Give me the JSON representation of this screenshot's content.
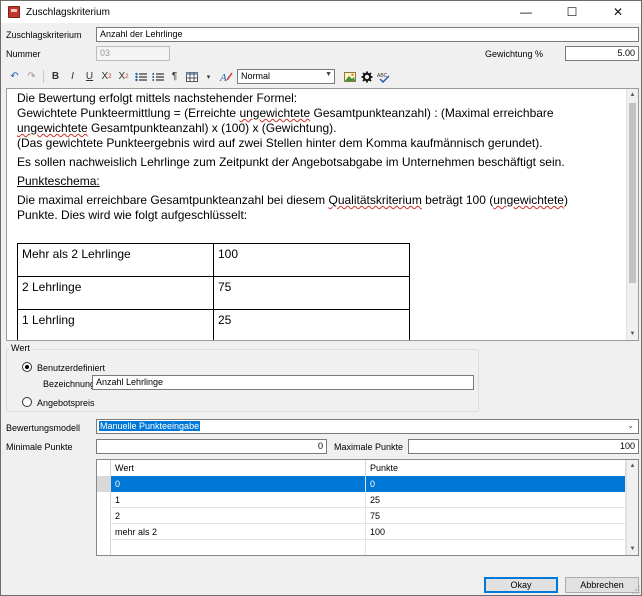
{
  "window": {
    "title": "Zuschlagskriterium",
    "minimize": "—",
    "maximize": "☐",
    "close": "✕"
  },
  "form": {
    "kriterium_label": "Zuschlagskriterium",
    "kriterium_value": "Anzahl der Lehrlinge",
    "nummer_label": "Nummer",
    "nummer_value": "03",
    "gewichtung_label": "Gewichtung %",
    "gewichtung_value": "5.00"
  },
  "toolbar": {
    "bold": "B",
    "italic": "I",
    "underline": "U",
    "superscript": "X",
    "subscript": "X",
    "superscript_mark": "2",
    "subscript_mark": "2",
    "paragraph": "¶",
    "style_value": "Normal"
  },
  "editor": {
    "line1": " Die Bewertung erfolgt mittels nachstehender Formel:",
    "formula_a": "Gewichtete Punkteermittlung = (Erreichte ",
    "formula_b": "ungewichtete",
    "formula_c": " Gesamtpunkteanzahl) : (Maximal erreichbare ",
    "formula_d": "ungewichtete",
    "formula_e": " Gesamtpunkteanzahl) x (100) x (Gewichtung).",
    "rounding": "(Das gewichtete Punkteergebnis wird auf zwei Stellen hinter dem Komma kaufmännisch gerundet).",
    "requirement": "Es sollen nachweislich Lehrlinge zum Zeitpunkt der Angebotsabgabe im Unternehmen beschäftigt sein.",
    "schema_heading": "Punkteschema:",
    "max_a": "Die maximal erreichbare Gesamtpunkteanzahl bei diesem ",
    "max_b": "Qualitätskriterium",
    "max_c": " beträgt 100 (",
    "max_d": "ungewichtete",
    "max_e": ")",
    "max_f": "Punkte.  Dies wird wie folgt aufgeschlüsselt:",
    "table": [
      {
        "label": "Mehr als 2 Lehrlinge",
        "points": "100"
      },
      {
        "label": "2 Lehrlinge",
        "points": "75"
      },
      {
        "label": "1 Lehrling",
        "points": "25"
      }
    ]
  },
  "wert": {
    "legend": "Wert",
    "option1": "Benutzerdefiniert",
    "bezeichnung_label": "Bezeichnung",
    "bezeichnung_value": "Anzahl Lehrlinge",
    "option2": "Angebotspreis"
  },
  "bewertung": {
    "label": "Bewertungsmodell",
    "value": "Manuelle Punkteeingabe",
    "min_label": "Minimale Punkte",
    "min_value": "0",
    "max_label": "Maximale Punkte",
    "max_value": "100"
  },
  "grid": {
    "col_wert": "Wert",
    "col_punkte": "Punkte",
    "rows": [
      {
        "wert": "0",
        "punkte": "0"
      },
      {
        "wert": "1",
        "punkte": "25"
      },
      {
        "wert": "2",
        "punkte": "75"
      },
      {
        "wert": "mehr als 2",
        "punkte": "100"
      }
    ]
  },
  "buttons": {
    "ok": "Okay",
    "cancel": "Abbrechen"
  },
  "colors": {
    "selection": "#0078d7",
    "spellcheck": "#d0302b"
  }
}
